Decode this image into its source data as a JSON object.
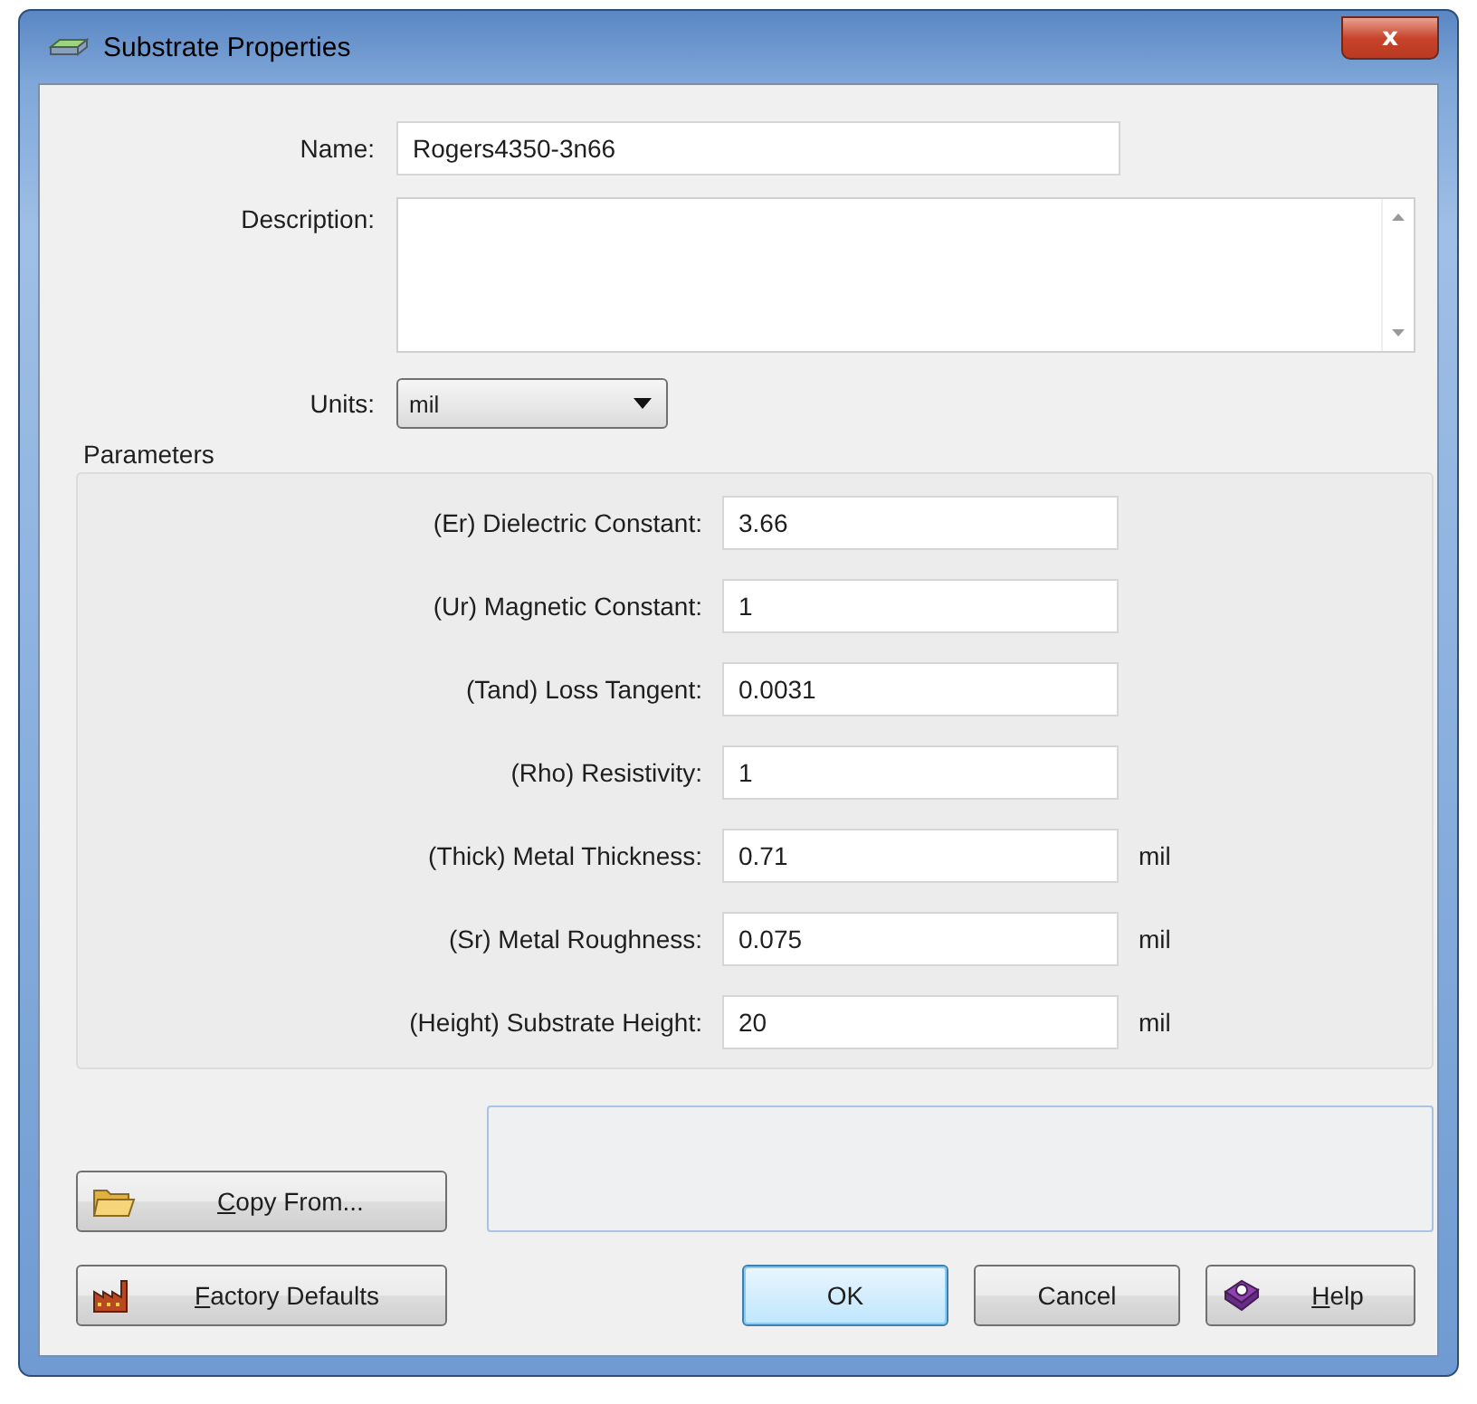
{
  "window": {
    "title": "Substrate Properties",
    "close_label": "x"
  },
  "name": {
    "label": "Name:",
    "value": "Rogers4350-3n66"
  },
  "description": {
    "label": "Description:"
  },
  "units": {
    "label": "Units:",
    "value": "mil"
  },
  "parameters": {
    "title": "Parameters",
    "rows": [
      {
        "label": "(Er) Dielectric Constant:",
        "value": "3.66"
      },
      {
        "label": "(Ur) Magnetic Constant:",
        "value": "1"
      },
      {
        "label": "(Tand) Loss Tangent:",
        "value": "0.0031"
      },
      {
        "label": "(Rho) Resistivity:",
        "value": "1"
      },
      {
        "label": "(Thick) Metal Thickness:",
        "value": "0.71",
        "unit": "mil"
      },
      {
        "label": "(Sr) Metal Roughness:",
        "value": "0.075",
        "unit": "mil"
      },
      {
        "label": "(Height) Substrate Height:",
        "value": "20",
        "unit": "mil"
      }
    ]
  },
  "copy_button": {
    "accel": "C",
    "rest": "opy From..."
  },
  "buttons": [
    {
      "kind": "factory",
      "accel": "F",
      "rest": "actory Defaults",
      "default": false
    },
    {
      "kind": "ok",
      "rest": "OK",
      "default": true
    },
    {
      "kind": "cancel",
      "rest": "Cancel",
      "default": false
    },
    {
      "kind": "help",
      "accel": "H",
      "rest": "elp",
      "default": false
    }
  ]
}
